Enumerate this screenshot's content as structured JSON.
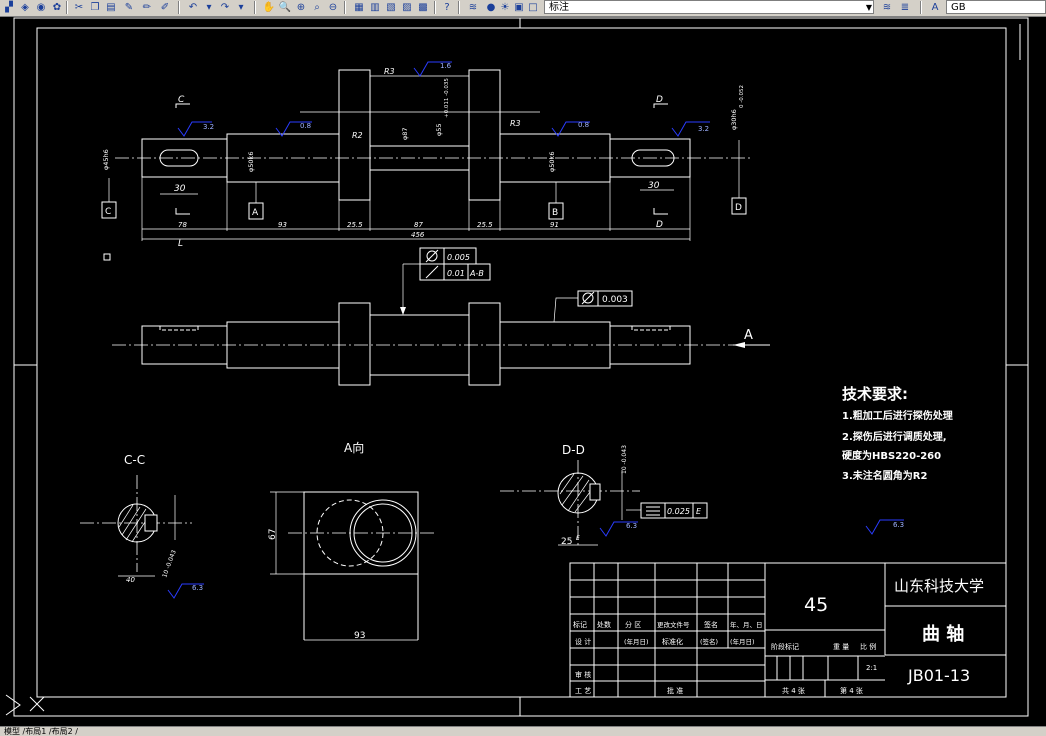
{
  "toolbar": {
    "layer_value": "标注",
    "textstyle_value": "GB"
  },
  "status": {
    "tabs": "模型 /布局1 /布局2 /"
  },
  "colors": {
    "background": "#000000",
    "lines": "#ffffff",
    "roughness": "#2a3cff",
    "toolbar": "#d4d0c8"
  },
  "drawing": {
    "top_view": {
      "section_c": "C",
      "section_d": "D",
      "datum_c": "C",
      "datum_a": "A",
      "datum_b": "B",
      "datum_d": "D",
      "rough_left": "3.2",
      "rough_mid1": "0.8",
      "rough_top": "1.6",
      "rough_mid2": "0.8",
      "rough_right": "3.2",
      "r3_a": "R3",
      "r3_b": "R3",
      "r2": "R2",
      "key_len_left": "30",
      "key_len_right": "30",
      "dim_78": "78",
      "dim_93": "93",
      "dim_25_5a": "25.5",
      "dim_87": "87",
      "dim_25_5b": "25.5",
      "dim_91": "91",
      "dim_total": "456",
      "dim_L": "L",
      "dia_left": "φ45h6",
      "dia_a": "φ50k6",
      "dia_center": "φ55",
      "dia_center_tol": "+0.011 -0.035",
      "dia_87": "φ87",
      "dia_b": "φ50k6",
      "dia_right": "φ30h6",
      "dia_right_tol": "0 -0.052"
    },
    "front_view": {
      "tol1_val": "0.005",
      "tol2_val": "0.01",
      "tol2_ref": "A-B",
      "tol3_val": "0.003",
      "arrow_label": "A"
    },
    "section_cc": {
      "title": "C-C",
      "dim_bottom": "40",
      "dim_tol": "10 -0.043",
      "rough": "6.3"
    },
    "view_a": {
      "title": "A向",
      "height": "67",
      "width": "93"
    },
    "section_dd": {
      "title": "D-D",
      "dim_tol": "10 -0.043",
      "sym_val": "0.025",
      "sym_ref": "E",
      "dim_25": "25",
      "e_label": "E",
      "rough": "6.3"
    },
    "rough_default": "6.3",
    "tech": {
      "title": "技术要求:",
      "line1": "1.粗加工后进行探伤处理",
      "line2": "2.探伤后进行调质处理,",
      "line3": "硬度为HBS220-260",
      "line4": "3.未注名圆角为R2"
    },
    "title_block": {
      "material": "45",
      "school": "山东科技大学",
      "part_name": "曲 轴",
      "drawing_no": "JB01-13",
      "h_mark": "标记",
      "h_count": "处数",
      "h_zone": "分 区",
      "h_doc": "更改文件号",
      "h_sign": "签名",
      "h_date": "年、月、日",
      "h_design": "设 计",
      "h_date2": "(年月日)",
      "h_std": "标准化",
      "h_sign2": "(签名)",
      "h_date3": "(年月日)",
      "h_review": "审 核",
      "h_process": "工 艺",
      "h_approve": "批 准",
      "h_stage": "阶段标记",
      "h_weight": "重 量",
      "h_scale": "比 例",
      "scale": "2:1",
      "sheets_total": "共 4 张",
      "sheet_no": "第 4 张"
    }
  }
}
